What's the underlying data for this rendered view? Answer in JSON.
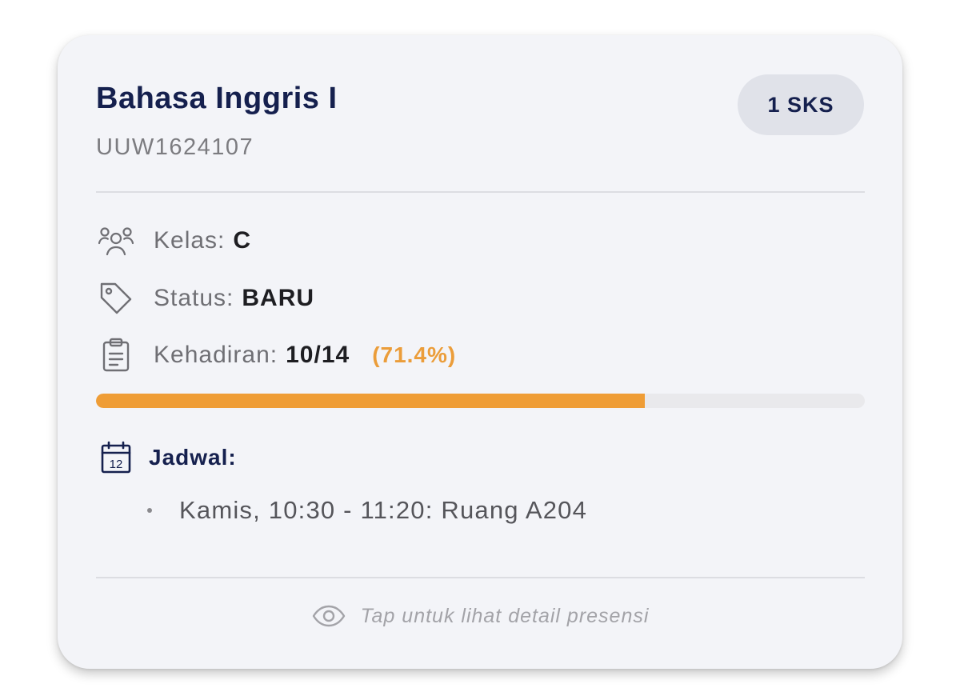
{
  "course": {
    "name": "Bahasa Inggris I",
    "code": "UUW1624107",
    "credits": "1 SKS"
  },
  "details": {
    "class_label": "Kelas:",
    "class_value": "C",
    "status_label": "Status:",
    "status_value": "BARU",
    "attendance_label": "Kehadiran:",
    "attendance_value": "10/14",
    "attendance_percent": "(71.4%)",
    "attendance_fraction": 0.714
  },
  "schedule": {
    "label": "Jadwal:",
    "items": [
      "Kamis, 10:30 - 11:20: Ruang A204"
    ],
    "calendar_day": "12"
  },
  "footer": {
    "hint": "Tap untuk lihat detail presensi"
  },
  "colors": {
    "accent": "#ef9d36",
    "title": "#15204e",
    "card_bg": "#f3f4f8"
  },
  "icons": {
    "class": "users-icon",
    "status": "tag-icon",
    "attendance": "clipboard-icon",
    "schedule": "calendar-icon",
    "footer": "eye-icon"
  }
}
